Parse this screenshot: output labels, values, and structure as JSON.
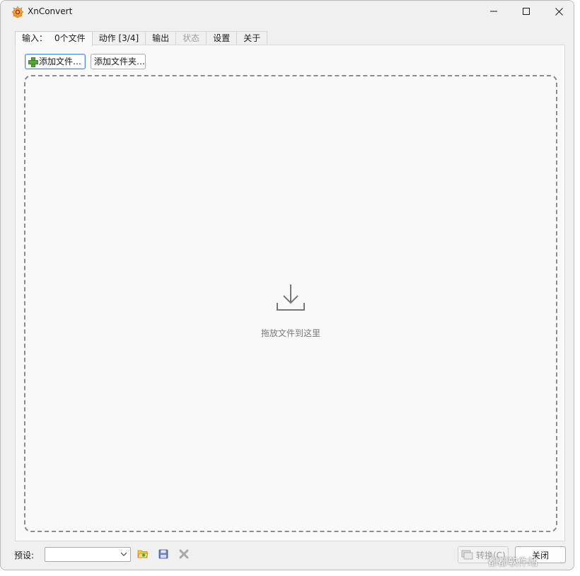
{
  "window": {
    "title": "XnConvert",
    "controls": {
      "minimize": "minimize",
      "maximize": "maximize",
      "close": "close"
    }
  },
  "tabs": [
    {
      "label": "输入：",
      "extra": "0个文件",
      "state": "active"
    },
    {
      "label": "动作 [3/4]",
      "state": "normal"
    },
    {
      "label": "输出",
      "state": "normal"
    },
    {
      "label": "状态",
      "state": "disabled"
    },
    {
      "label": "设置",
      "state": "normal"
    },
    {
      "label": "关于",
      "state": "normal"
    }
  ],
  "input": {
    "add_files_label": "添加文件…",
    "add_folder_label": "添加文件夹…",
    "drop_text": "拖放文件到这里"
  },
  "bottom": {
    "preset_label": "预设:",
    "preset_value": "",
    "convert_label": "转换(C)",
    "close_label": "关闭"
  },
  "watermark": "都都软件站",
  "colors": {
    "accent": "#4d8ad9",
    "window_bg": "#f0f0f0",
    "panel_bg": "#f9f9f9",
    "dash": "#8c8c8c"
  }
}
